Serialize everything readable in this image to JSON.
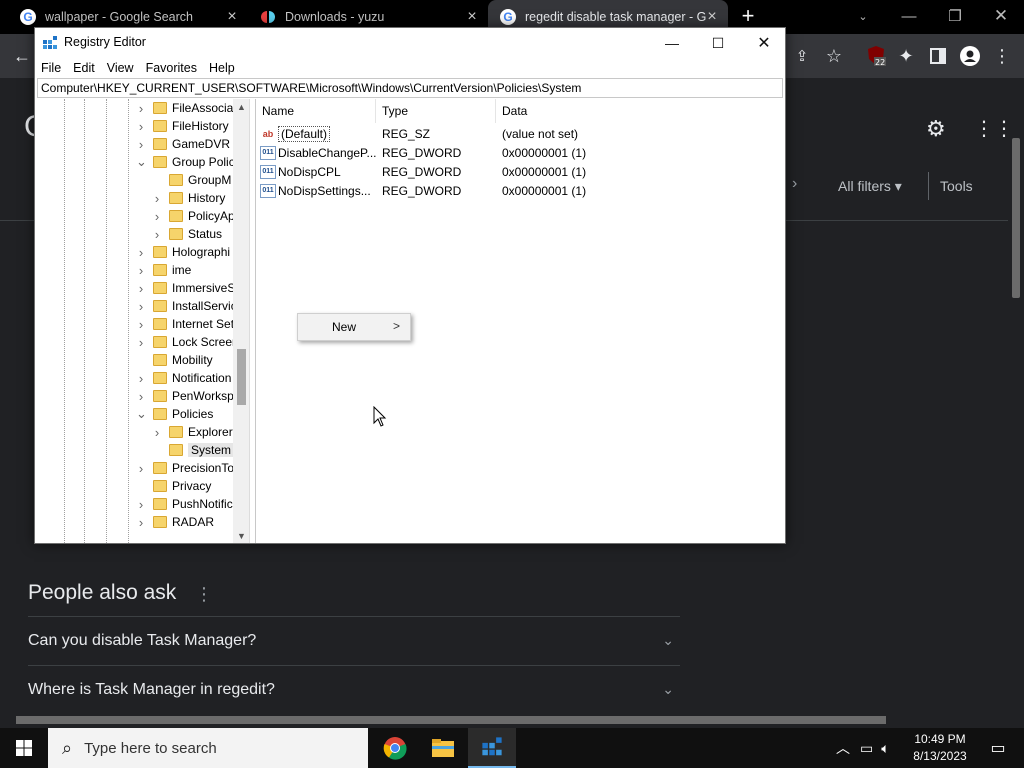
{
  "browser": {
    "tabs": [
      {
        "title": "wallpaper - Google Search",
        "favicon": "google-icon"
      },
      {
        "title": "Downloads - yuzu",
        "favicon": "yuzu-icon"
      },
      {
        "title": "regedit disable task manager - G",
        "favicon": "google-icon",
        "active": true
      }
    ],
    "extension_badge": "22",
    "page": {
      "all_filters": "All filters",
      "tools": "Tools",
      "people_also_ask": "People also ask",
      "questions": [
        "Can you disable Task Manager?",
        "Where is Task Manager in regedit?"
      ]
    }
  },
  "regedit": {
    "title": "Registry Editor",
    "menu": [
      "File",
      "Edit",
      "View",
      "Favorites",
      "Help"
    ],
    "address": "Computer\\HKEY_CURRENT_USER\\SOFTWARE\\Microsoft\\Windows\\CurrentVersion\\Policies\\System",
    "tree": [
      {
        "label": "FileAssocia",
        "level": 1,
        "expander": ">"
      },
      {
        "label": "FileHistory",
        "level": 1,
        "expander": ">"
      },
      {
        "label": "GameDVR",
        "level": 1,
        "expander": ">"
      },
      {
        "label": "Group Polic",
        "level": 1,
        "expander": "v"
      },
      {
        "label": "GroupM",
        "level": 2,
        "expander": ""
      },
      {
        "label": "History",
        "level": 2,
        "expander": ">"
      },
      {
        "label": "PolicyAp",
        "level": 2,
        "expander": ">"
      },
      {
        "label": "Status",
        "level": 2,
        "expander": ">"
      },
      {
        "label": "Holographi",
        "level": 1,
        "expander": ">"
      },
      {
        "label": "ime",
        "level": 1,
        "expander": ">"
      },
      {
        "label": "ImmersiveS",
        "level": 1,
        "expander": ">"
      },
      {
        "label": "InstallServic",
        "level": 1,
        "expander": ">"
      },
      {
        "label": "Internet Set",
        "level": 1,
        "expander": ">"
      },
      {
        "label": "Lock Screen",
        "level": 1,
        "expander": ">"
      },
      {
        "label": "Mobility",
        "level": 1,
        "expander": ""
      },
      {
        "label": "Notification",
        "level": 1,
        "expander": ">"
      },
      {
        "label": "PenWorksp",
        "level": 1,
        "expander": ">"
      },
      {
        "label": "Policies",
        "level": 1,
        "expander": "v"
      },
      {
        "label": "Explorer",
        "level": 2,
        "expander": ">"
      },
      {
        "label": "System",
        "level": 2,
        "expander": "",
        "selected": true
      },
      {
        "label": "PrecisionTo",
        "level": 1,
        "expander": ">"
      },
      {
        "label": "Privacy",
        "level": 1,
        "expander": ""
      },
      {
        "label": "PushNotific",
        "level": 1,
        "expander": ">"
      },
      {
        "label": "RADAR",
        "level": 1,
        "expander": ">"
      }
    ],
    "columns": [
      "Name",
      "Type",
      "Data"
    ],
    "values": [
      {
        "name": "(Default)",
        "type": "REG_SZ",
        "data": "(value not set)",
        "icon": "string-value-icon"
      },
      {
        "name": "DisableChangeP...",
        "type": "REG_DWORD",
        "data": "0x00000001 (1)",
        "icon": "dword-value-icon"
      },
      {
        "name": "NoDispCPL",
        "type": "REG_DWORD",
        "data": "0x00000001 (1)",
        "icon": "dword-value-icon"
      },
      {
        "name": "NoDispSettings...",
        "type": "REG_DWORD",
        "data": "0x00000001 (1)",
        "icon": "dword-value-icon"
      }
    ],
    "context_menu": {
      "item": "New",
      "arrow": ">"
    }
  },
  "taskbar": {
    "search_placeholder": "Type here to search",
    "time": "10:49 PM",
    "date": "8/13/2023"
  },
  "colors": {
    "page_bg": "#202124",
    "tab_active": "#35363a",
    "folder": "#f6d46b",
    "taskbar": "#101010"
  }
}
